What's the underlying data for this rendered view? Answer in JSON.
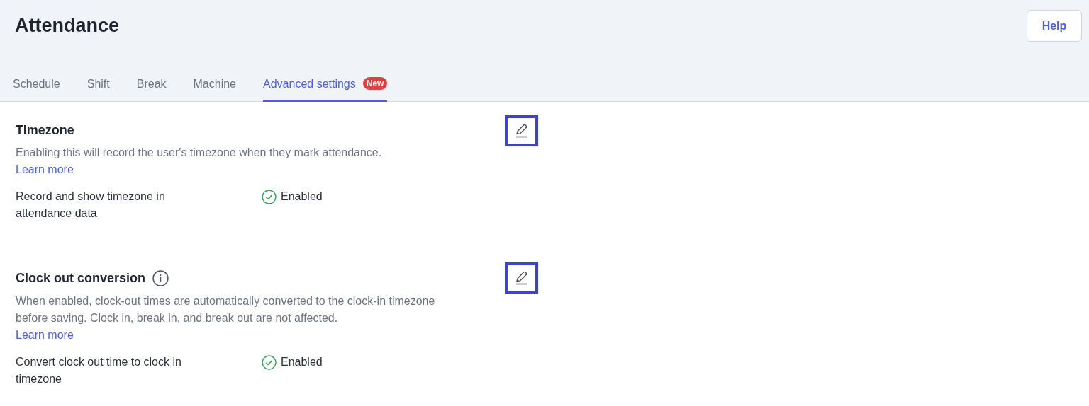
{
  "page": {
    "title": "Attendance",
    "help_button": "Help"
  },
  "tabs": [
    {
      "label": "Schedule",
      "selected": false
    },
    {
      "label": "Shift",
      "selected": false
    },
    {
      "label": "Break",
      "selected": false
    },
    {
      "label": "Machine",
      "selected": false
    },
    {
      "label": "Advanced settings",
      "selected": true,
      "badge": "New"
    }
  ],
  "sections": [
    {
      "title": "Timezone",
      "info": false,
      "description": "Enabling this will record the user's timezone when they mark attendance.",
      "link": "Learn more",
      "setting": {
        "label": "Record and show timezone in attendance data",
        "status": "Enabled",
        "enabled": true
      }
    },
    {
      "title": "Clock out conversion",
      "info": true,
      "description": "When enabled, clock-out times are automatically converted to the clock-in timezone before saving. Clock in, break in, and break out are not affected.",
      "link": "Learn more",
      "setting": {
        "label": "Convert clock out time to clock in timezone",
        "status": "Enabled",
        "enabled": true
      }
    }
  ]
}
